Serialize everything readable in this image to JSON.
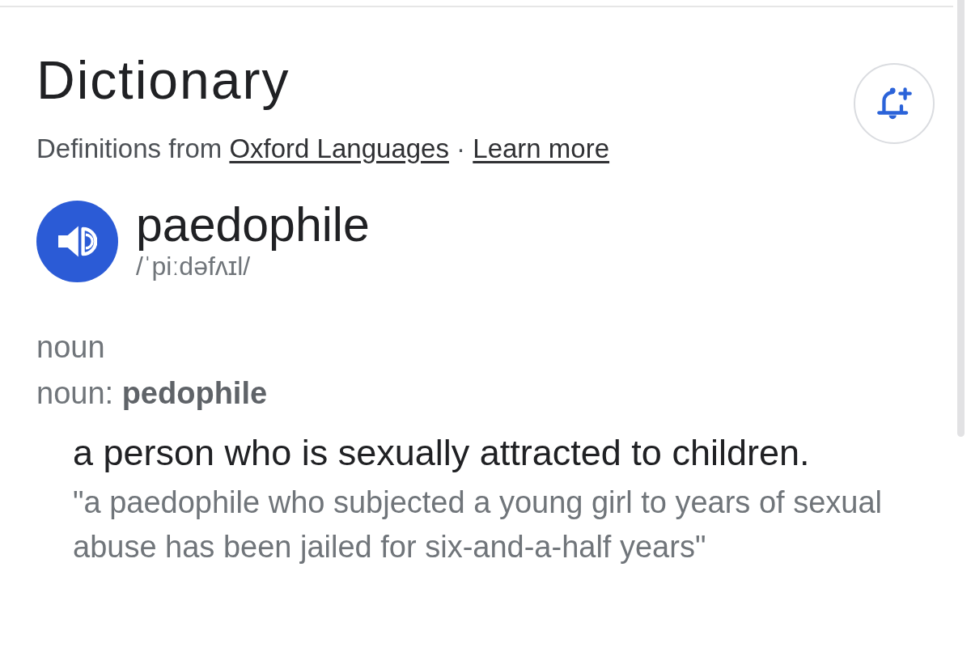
{
  "header": {
    "title": "Dictionary",
    "attribution": {
      "prefix": "Definitions from",
      "source_link": "Oxford Languages",
      "separator": "·",
      "learn_more_link": "Learn more"
    }
  },
  "entry": {
    "word": "paedophile",
    "phonetic": "/ˈpiːdəfʌɪl/"
  },
  "sense": {
    "part_of_speech": "noun",
    "variant": "noun: **pedophile**",
    "definition": "a person who is sexually attracted to children.",
    "example": "\"a paedophile who subjected a young girl to years of sexual abuse has been jailed for six-and-a-half years\""
  }
}
